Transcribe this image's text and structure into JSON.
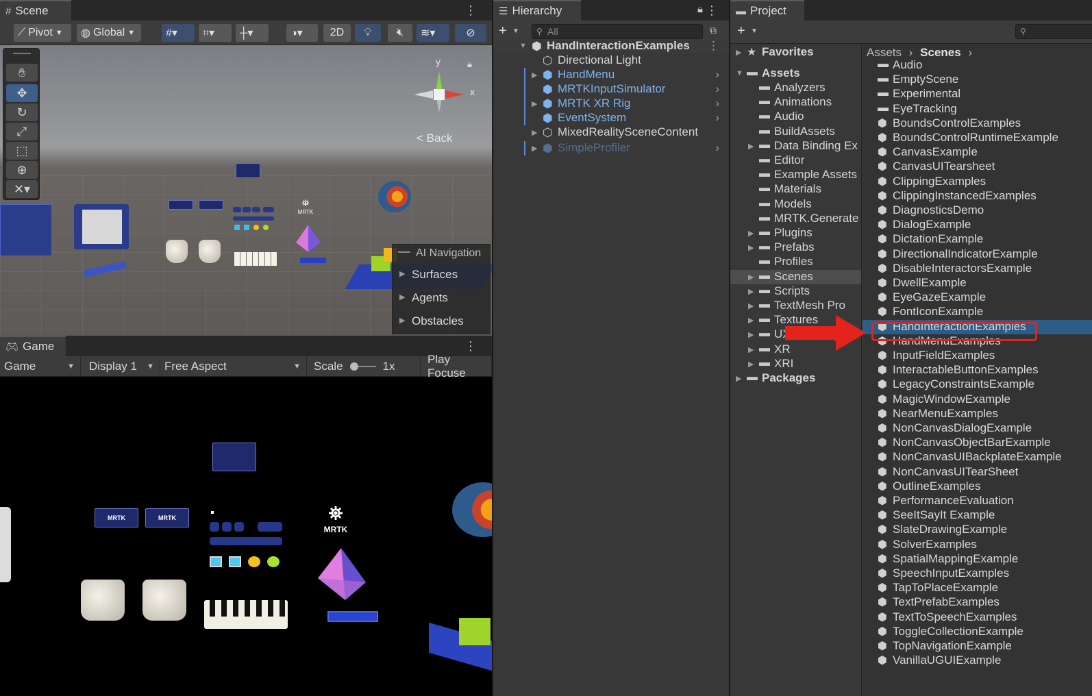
{
  "scene": {
    "tab": "Scene",
    "toolbar": {
      "pivot": "Pivot",
      "global": "Global",
      "mode_2d": "2D"
    },
    "gizmo": {
      "y": "y",
      "x": "x",
      "back": "< Back"
    },
    "ai_nav": {
      "title": "AI Navigation",
      "items": [
        "Surfaces",
        "Agents",
        "Obstacles"
      ]
    },
    "mrtk_label": "MRTK"
  },
  "game": {
    "tab": "Game",
    "toolbar": {
      "mode": "Game",
      "display": "Display 1",
      "aspect": "Free Aspect",
      "scale_label": "Scale",
      "scale_value": "1x",
      "play_focus": "Play Focuse"
    },
    "mrtk_label": "MRTK",
    "card_logo": "MRTK"
  },
  "hierarchy": {
    "tab": "Hierarchy",
    "search_placeholder": "All",
    "root": "HandInteractionExamples",
    "items": [
      {
        "label": "Directional Light"
      },
      {
        "label": "HandMenu"
      },
      {
        "label": "MRTKInputSimulator"
      },
      {
        "label": "MRTK XR Rig"
      },
      {
        "label": "EventSystem"
      },
      {
        "label": "MixedRealitySceneContent"
      },
      {
        "label": "SimpleProfiler"
      }
    ]
  },
  "project": {
    "tab": "Project",
    "favorites": "Favorites",
    "assets": "Assets",
    "packages": "Packages",
    "folders": [
      "Analyzers",
      "Animations",
      "Audio",
      "BuildAssets",
      "Data Binding Ex",
      "Editor",
      "Example Assets",
      "Materials",
      "Models",
      "MRTK.Generate",
      "Plugins",
      "Prefabs",
      "Profiles",
      "Scenes",
      "Scripts",
      "TextMesh Pro",
      "Textures",
      "UX Theming E",
      "XR",
      "XRI"
    ],
    "breadcrumb": {
      "root": "Assets",
      "current": "Scenes"
    },
    "subfolders": [
      "Audio",
      "EmptyScene",
      "Experimental",
      "EyeTracking"
    ],
    "scenes": [
      "BoundsControlExamples",
      "BoundsControlRuntimeExample",
      "CanvasExample",
      "CanvasUITearsheet",
      "ClippingExamples",
      "ClippingInstancedExamples",
      "DiagnosticsDemo",
      "DialogExample",
      "DictationExample",
      "DirectionalIndicatorExample",
      "DisableInteractorsExample",
      "DwellExample",
      "EyeGazeExample",
      "FontIconExample",
      "HandInteractionExamples",
      "HandMenuExamples",
      "InputFieldExamples",
      "InteractableButtonExamples",
      "LegacyConstraintsExample",
      "MagicWindowExample",
      "NearMenuExamples",
      "NonCanvasDialogExample",
      "NonCanvasObjectBarExample",
      "NonCanvasUIBackplateExample",
      "NonCanvasUITearSheet",
      "OutlineExamples",
      "PerformanceEvaluation",
      "SeeItSayIt Example",
      "SlateDrawingExample",
      "SolverExamples",
      "SpatialMappingExample",
      "SpeechInputExamples",
      "TapToPlaceExample",
      "TextPrefabExamples",
      "TextToSpeechExamples",
      "ToggleCollectionExample",
      "TopNavigationExample",
      "VanillaUGUIExample"
    ],
    "selected_scene": "HandInteractionExamples"
  },
  "colors": {
    "accent": "#2c5d87",
    "annotation": "#e5231d",
    "prefab": "#7fb2ee"
  }
}
